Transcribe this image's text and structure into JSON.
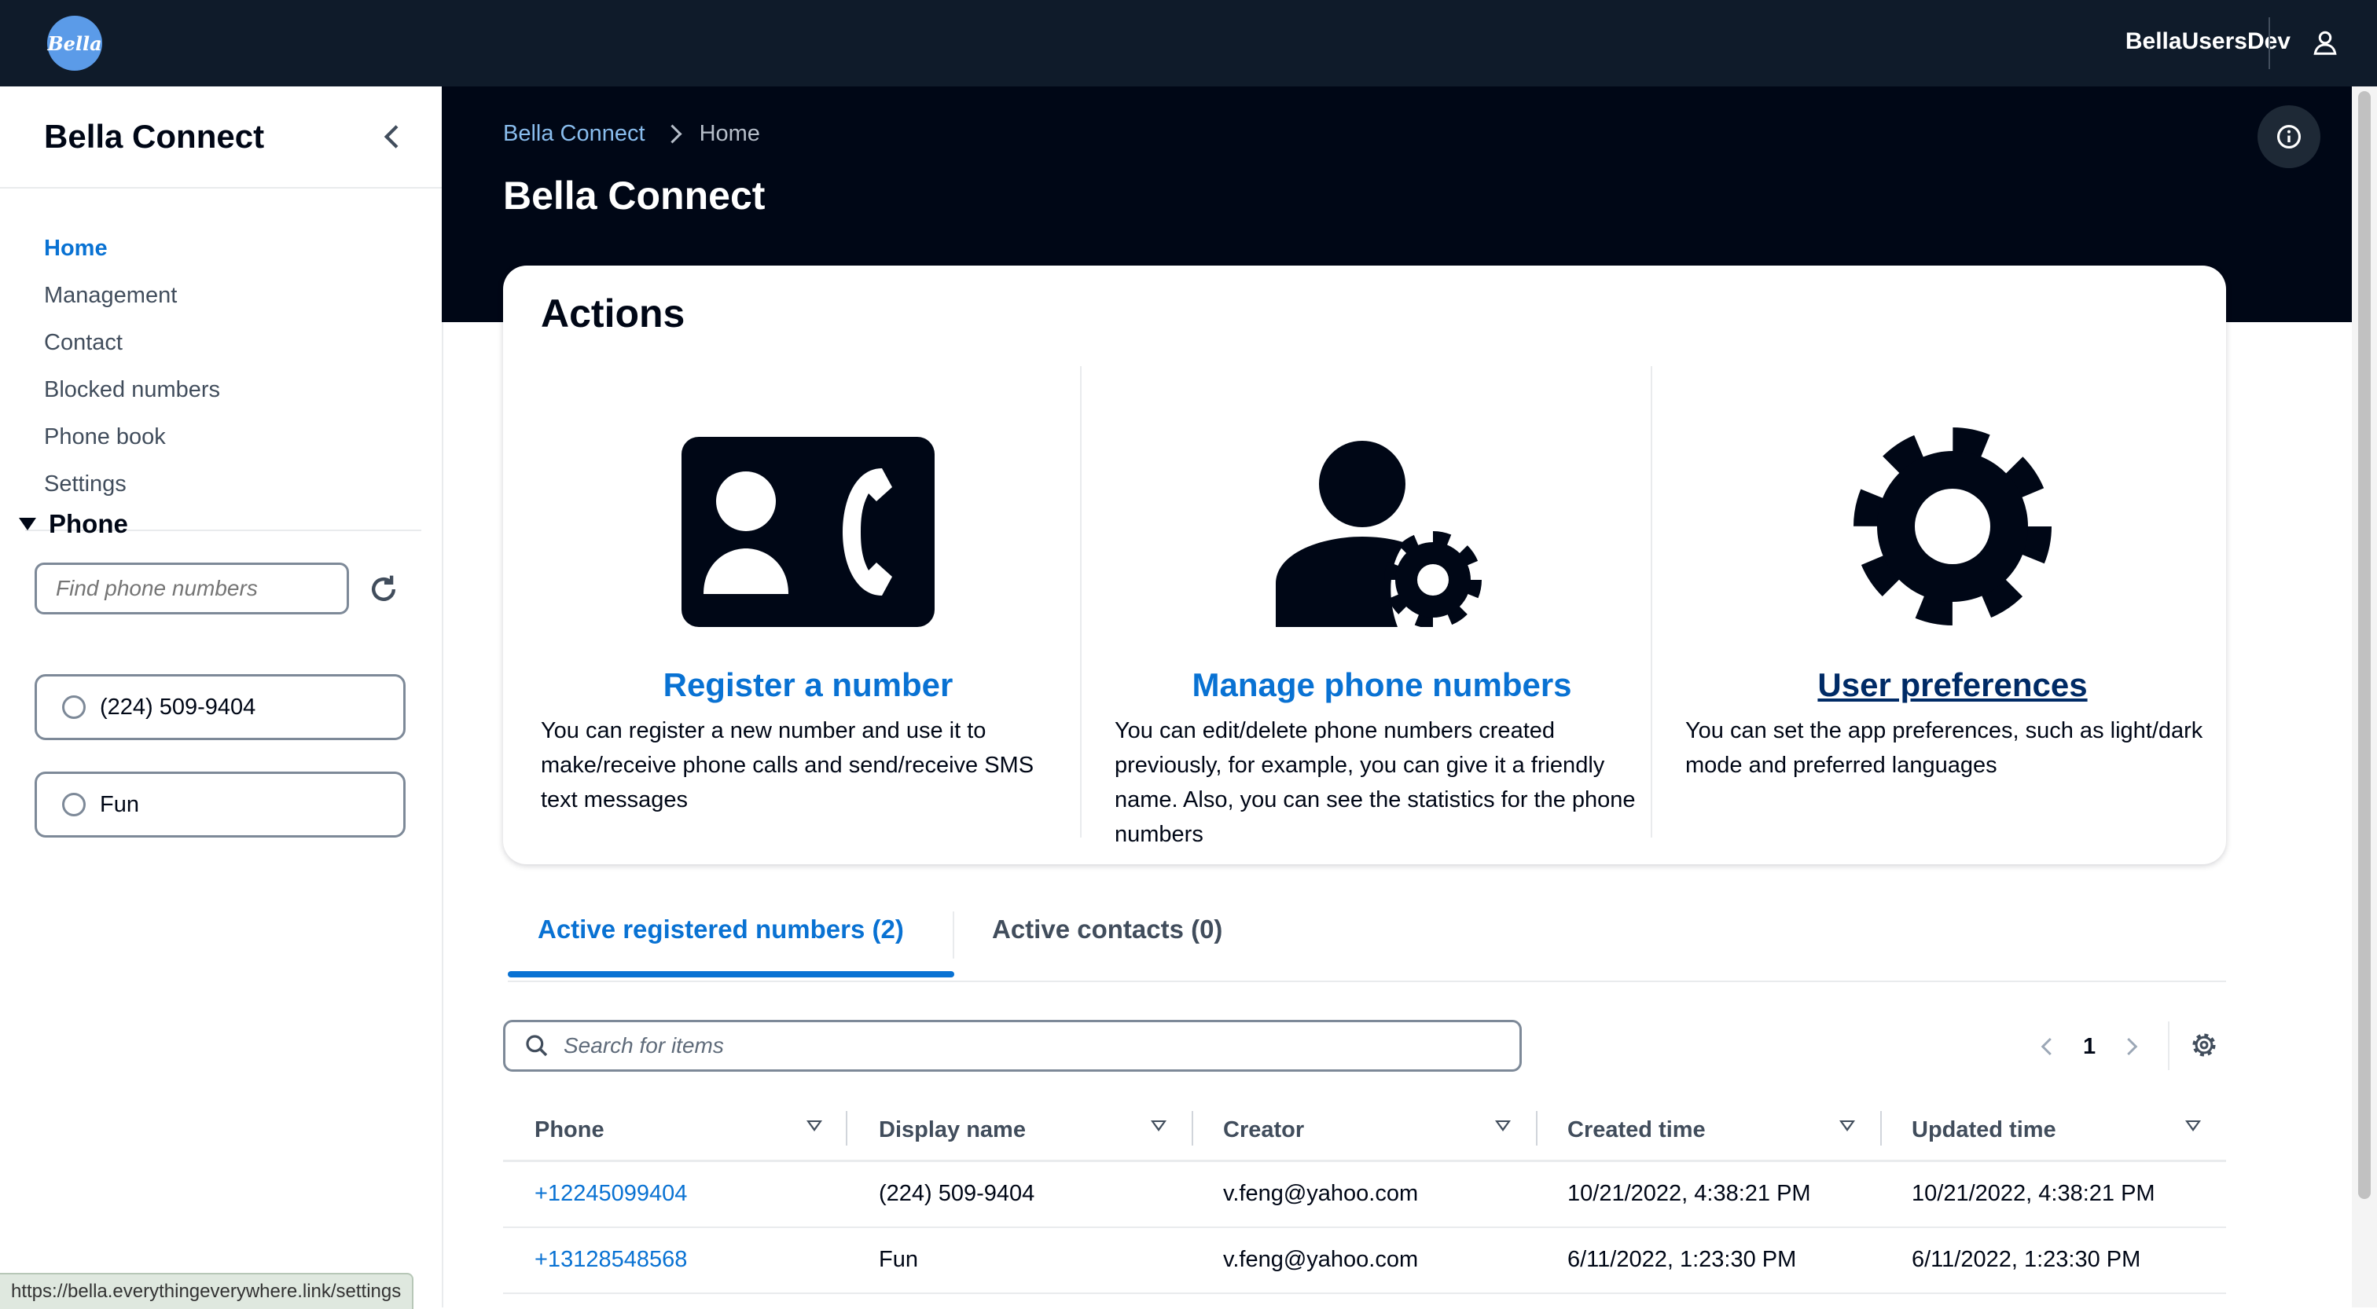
{
  "topbar": {
    "logo_text": "Bella",
    "username": "BellaUsersDev",
    "user_icon": "user-icon"
  },
  "sidebar": {
    "title": "Bella Connect",
    "collapse_icon": "chevron-left-icon",
    "nav": [
      "Home",
      "Management",
      "Contact",
      "Blocked numbers",
      "Phone book",
      "Settings"
    ],
    "active_nav": "Home",
    "phone_section": {
      "label": "Phone",
      "search_placeholder": "Find phone numbers",
      "refresh_icon": "refresh-icon",
      "options": [
        "(224) 509-9404",
        "Fun"
      ]
    }
  },
  "status_bar_url": "https://bella.everythingeverywhere.link/settings",
  "header": {
    "breadcrumb": {
      "link": "Bella Connect",
      "current": "Home"
    },
    "title": "Bella Connect",
    "info_icon": "info-icon"
  },
  "actions": {
    "title": "Actions",
    "items": [
      {
        "icon": "contact-phone-icon",
        "link": "Register a number",
        "description": "You can register a new number and use it to make/receive phone calls and send/receive SMS text messages"
      },
      {
        "icon": "manage-account-icon",
        "link": "Manage phone numbers",
        "description": "You can edit/delete phone numbers created previously, for example, you can give it a friendly name. Also, you can see the statistics for the phone numbers"
      },
      {
        "icon": "settings-gear-icon",
        "link": "User preferences",
        "description": "You can set the app preferences, such as light/dark mode and preferred languages"
      }
    ]
  },
  "tabs": [
    {
      "label": "Active registered numbers (2)",
      "active": true
    },
    {
      "label": "Active contacts (0)",
      "active": false
    }
  ],
  "table_controls": {
    "search_placeholder": "Search for items",
    "page": "1"
  },
  "table": {
    "columns": [
      "Phone",
      "Display name",
      "Creator",
      "Created time",
      "Updated time"
    ],
    "rows": [
      [
        "+12245099404",
        "(224) 509-9404",
        "v.feng@yahoo.com",
        "10/21/2022, 4:38:21 PM",
        "10/21/2022, 4:38:21 PM"
      ],
      [
        "+13128548568",
        "Fun",
        "v.feng@yahoo.com",
        "6/11/2022, 1:23:30 PM",
        "6/11/2022, 1:23:30 PM"
      ]
    ]
  }
}
